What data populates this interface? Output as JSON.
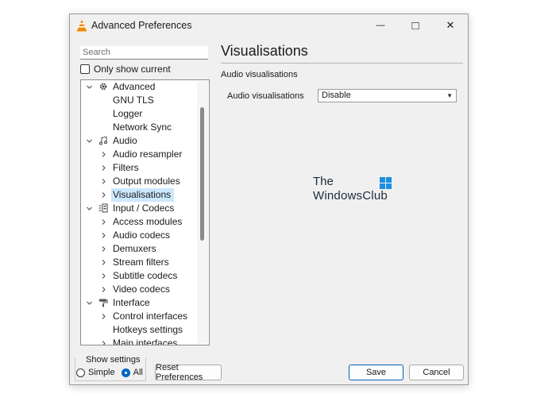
{
  "window": {
    "title": "Advanced Preferences",
    "controls": {
      "minimize": "—",
      "maximize": "□",
      "close": "✕"
    }
  },
  "search": {
    "placeholder": "Search",
    "value": ""
  },
  "only_show_current": {
    "label": "Only show current",
    "checked": false
  },
  "tree": {
    "items": [
      {
        "label": "Advanced",
        "level": 0,
        "expander": "expanded",
        "icon": "gear-icon"
      },
      {
        "label": "GNU TLS",
        "level": 1,
        "expander": "none"
      },
      {
        "label": "Logger",
        "level": 1,
        "expander": "none"
      },
      {
        "label": "Network Sync",
        "level": 1,
        "expander": "none"
      },
      {
        "label": "Audio",
        "level": 0,
        "expander": "expanded",
        "icon": "music-note-icon"
      },
      {
        "label": "Audio resampler",
        "level": 1,
        "expander": "collapsed"
      },
      {
        "label": "Filters",
        "level": 1,
        "expander": "collapsed"
      },
      {
        "label": "Output modules",
        "level": 1,
        "expander": "collapsed"
      },
      {
        "label": "Visualisations",
        "level": 1,
        "expander": "collapsed",
        "selected": true
      },
      {
        "label": "Input / Codecs",
        "level": 0,
        "expander": "expanded",
        "icon": "codec-icon"
      },
      {
        "label": "Access modules",
        "level": 1,
        "expander": "collapsed"
      },
      {
        "label": "Audio codecs",
        "level": 1,
        "expander": "collapsed"
      },
      {
        "label": "Demuxers",
        "level": 1,
        "expander": "collapsed"
      },
      {
        "label": "Stream filters",
        "level": 1,
        "expander": "collapsed"
      },
      {
        "label": "Subtitle codecs",
        "level": 1,
        "expander": "collapsed"
      },
      {
        "label": "Video codecs",
        "level": 1,
        "expander": "collapsed"
      },
      {
        "label": "Interface",
        "level": 0,
        "expander": "expanded",
        "icon": "paint-roller-icon"
      },
      {
        "label": "Control interfaces",
        "level": 1,
        "expander": "collapsed"
      },
      {
        "label": "Hotkeys settings",
        "level": 1,
        "expander": "none"
      },
      {
        "label": "Main interfaces",
        "level": 1,
        "expander": "collapsed"
      }
    ]
  },
  "panel": {
    "title": "Visualisations",
    "section": "Audio visualisations",
    "field_label": "Audio visualisations",
    "select_value": "Disable"
  },
  "watermark": {
    "line1": "The",
    "line2": "WindowsClub"
  },
  "show_settings": {
    "title": "Show settings",
    "options": [
      {
        "label": "Simple",
        "selected": false
      },
      {
        "label": "All",
        "selected": true
      }
    ]
  },
  "buttons": {
    "reset": "Reset Preferences",
    "save": "Save",
    "cancel": "Cancel"
  },
  "colors": {
    "selection": "#cce8ff",
    "accent": "#0067c0",
    "window_bg": "#f0f0f0"
  }
}
